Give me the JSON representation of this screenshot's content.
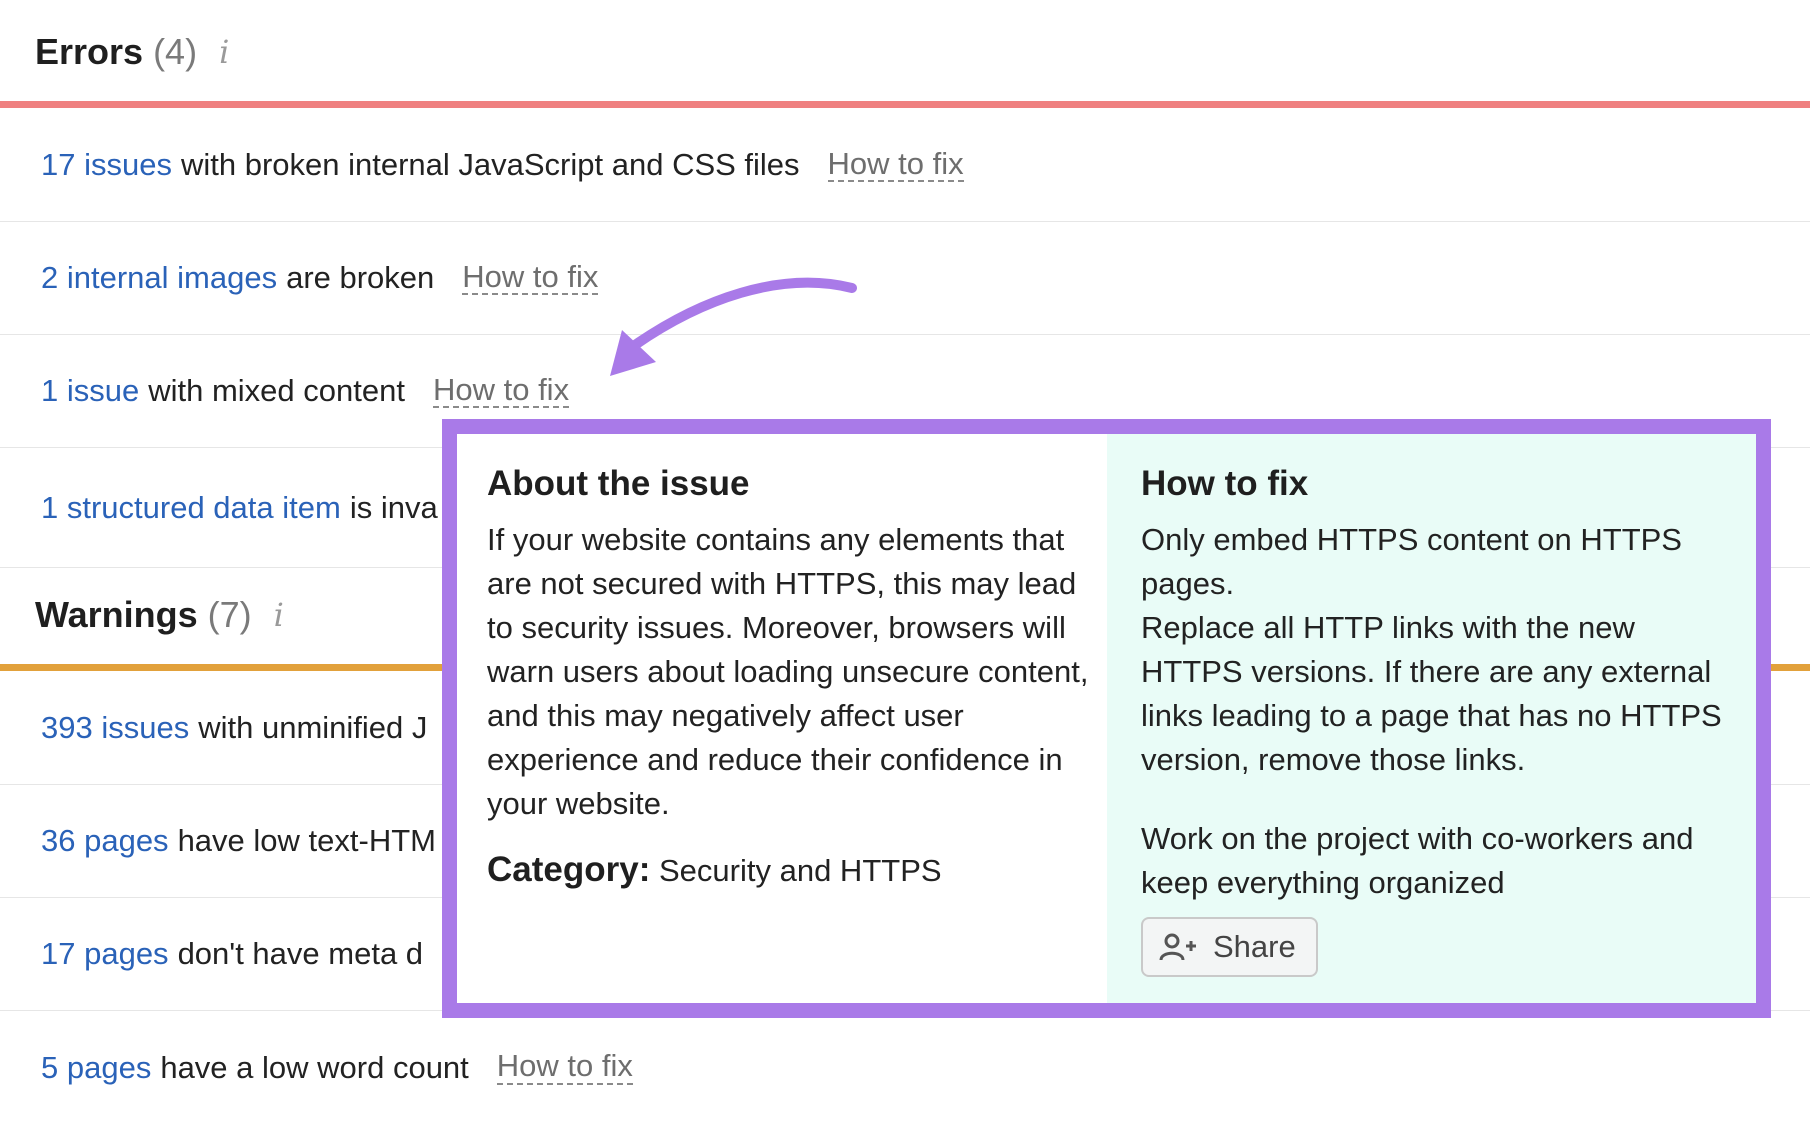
{
  "colors": {
    "errors_bar": "#ef8080",
    "warnings_bar": "#e2a13b",
    "link": "#2a62b8",
    "popup_border": "#a97ae8",
    "arrow": "#a97ae8",
    "howto_bg": "#e9fcf7"
  },
  "errors": {
    "title": "Errors",
    "count": "(4)",
    "info_icon": "i",
    "rows": [
      {
        "count": "17 issues",
        "desc": "with broken internal JavaScript and CSS files",
        "fix": "How to fix"
      },
      {
        "count": "2 internal images",
        "desc": "are broken",
        "fix": "How to fix"
      },
      {
        "count": "1 issue",
        "desc": "with mixed content",
        "fix": "How to fix"
      },
      {
        "count": "1 structured data item",
        "desc": "is inva"
      }
    ]
  },
  "warnings": {
    "title": "Warnings",
    "count": "(7)",
    "info_icon": "i",
    "rows": [
      {
        "count": "393 issues",
        "desc": "with unminified J"
      },
      {
        "count": "36 pages",
        "desc": "have low text-HTM"
      },
      {
        "count": "17 pages",
        "desc": "don't have meta d"
      },
      {
        "count": "5 pages",
        "desc": "have a low word count",
        "fix": "How to fix"
      }
    ]
  },
  "popup": {
    "about_title": "About the issue",
    "about_text": "If your website contains any elements that are not secured with HTTPS, this may lead to security issues. Moreover, browsers will warn users about loading unsecure content, and this may negatively affect user experience and reduce their confidence in your website.",
    "category_label": "Category:",
    "category_value": "Security and HTTPS",
    "howto_title": "How to fix",
    "howto_line1": "Only embed HTTPS content on HTTPS pages.",
    "howto_line2": "Replace all HTTP links with the new HTTPS versions. If there are any external links leading to a page that has no HTTPS version, remove those links.",
    "cowork_text": "Work on the project with co-workers and keep everything organized",
    "share_label": "Share",
    "share_icon": "add-user-icon"
  }
}
